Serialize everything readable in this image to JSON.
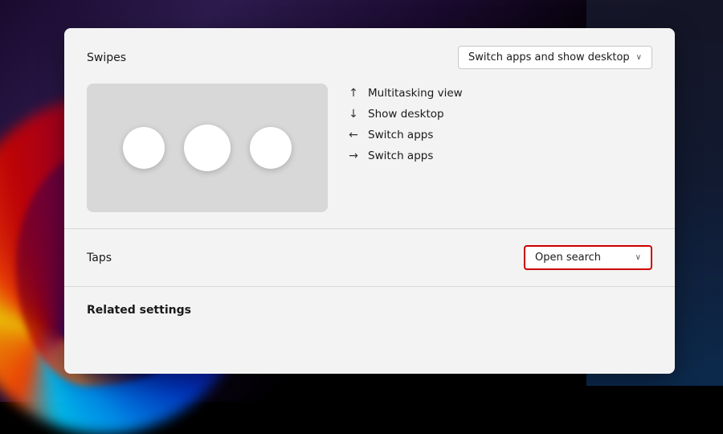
{
  "background": {
    "color": "#000"
  },
  "panel": {
    "swipes": {
      "label": "Swipes",
      "dropdown": {
        "value": "Switch apps and show desktop",
        "chevron": "∨"
      },
      "gesture_options": [
        {
          "arrow": "↑",
          "label": "Multitasking view"
        },
        {
          "arrow": "↓",
          "label": "Show desktop"
        },
        {
          "arrow": "←",
          "label": "Switch apps"
        },
        {
          "arrow": "→",
          "label": "Switch apps"
        }
      ]
    },
    "taps": {
      "label": "Taps",
      "dropdown": {
        "value": "Open search",
        "chevron": "∨"
      }
    },
    "related_settings": {
      "label": "Related settings"
    }
  }
}
